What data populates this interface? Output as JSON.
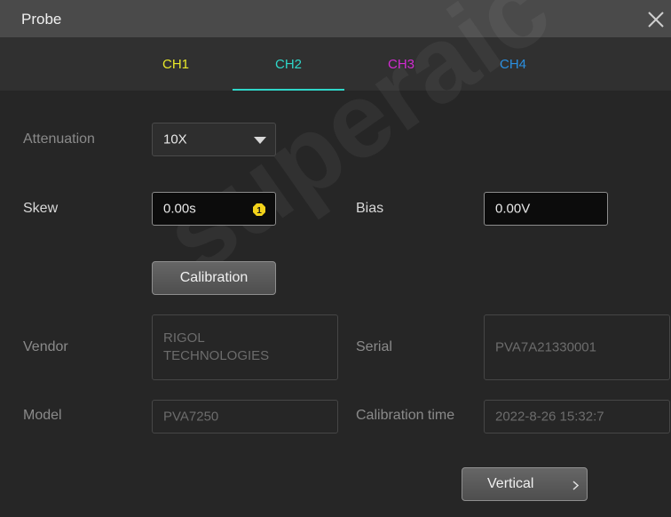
{
  "dialog": {
    "title": "Probe"
  },
  "tabs": [
    {
      "label": "CH1",
      "color": "#e8e82a"
    },
    {
      "label": "CH2",
      "color": "#2fd6c8",
      "active": true
    },
    {
      "label": "CH3",
      "color": "#d12bd1"
    },
    {
      "label": "CH4",
      "color": "#2a8fe0"
    }
  ],
  "attenuation": {
    "label": "Attenuation",
    "value": "10X"
  },
  "skew": {
    "label": "Skew",
    "value": "0.00s",
    "badge": "1"
  },
  "bias": {
    "label": "Bias",
    "value": "0.00V"
  },
  "calibration_button": "Calibration",
  "vendor": {
    "label": "Vendor",
    "line1": "RIGOL",
    "line2": "TECHNOLOGIES"
  },
  "serial": {
    "label": "Serial",
    "value": "PVA7A21330001"
  },
  "model": {
    "label": "Model",
    "value": "PVA7250"
  },
  "calibration_time": {
    "label": "Calibration time",
    "value": "2022-8-26 15:32:7"
  },
  "vertical_button": "Vertical",
  "watermark": "superaic"
}
